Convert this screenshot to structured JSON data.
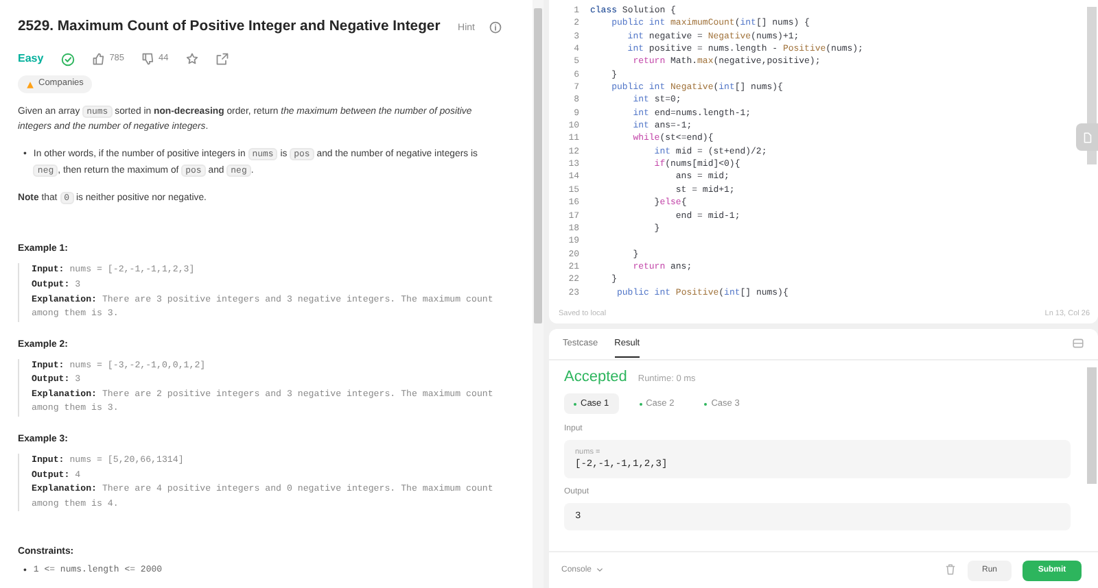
{
  "problem": {
    "title": "2529. Maximum Count of Positive Integer and Negative Integer",
    "hint": "Hint",
    "difficulty": "Easy",
    "solved": true,
    "likes": "785",
    "dislikes": "44",
    "companies": "Companies",
    "description": [
      {
        "kind": "plain",
        "text": "Given an array "
      },
      {
        "kind": "code",
        "text": "nums"
      },
      {
        "kind": "plain",
        "text": " sorted in "
      },
      {
        "kind": "bold",
        "text": "non-decreasing"
      },
      {
        "kind": "plain",
        "text": " order, return "
      },
      {
        "kind": "italic",
        "text": "the maximum between the number of positive integers and the number of negative integers"
      },
      {
        "kind": "plain",
        "text": "."
      }
    ],
    "bullets": [
      {
        "marker": "•",
        "text": [
          {
            "kind": "plain",
            "text": "In other words, if the number of positive integers in "
          },
          {
            "kind": "code",
            "text": "nums"
          },
          {
            "kind": "plain",
            "text": " is "
          },
          {
            "kind": "code",
            "text": "pos"
          },
          {
            "kind": "plain",
            "text": " and the number of negative integers is "
          },
          {
            "kind": "code",
            "text": "neg"
          },
          {
            "kind": "plain",
            "text": ", then return the maximum of "
          },
          {
            "kind": "code",
            "text": "pos"
          },
          {
            "kind": "plain",
            "text": " and "
          },
          {
            "kind": "code",
            "text": "neg"
          },
          {
            "kind": "plain",
            "text": "."
          }
        ]
      }
    ],
    "note": [
      {
        "kind": "bold",
        "text": "Note"
      },
      {
        "kind": "plain",
        "text": " that "
      },
      {
        "kind": "code",
        "text": "0"
      },
      {
        "kind": "plain",
        "text": " is neither positive nor negative."
      }
    ],
    "examples": [
      {
        "title": "Example 1:",
        "lines": [
          "**Input:** nums = [-2,-1,-1,1,2,3]",
          "**Output:** 3",
          "**Explanation:** There are 3 positive integers and 3 negative integers. The maximum count among them is 3."
        ]
      },
      {
        "title": "Example 2:",
        "lines": [
          "**Input:** nums = [-3,-2,-1,0,0,1,2]",
          "**Output:** 3",
          "**Explanation:** There are 2 positive integers and 3 negative integers. The maximum count among them is 3."
        ]
      },
      {
        "title": "Example 3:",
        "lines": [
          "**Input:** nums = [5,20,66,1314]",
          "**Output:** 4",
          "**Explanation:** There are 4 positive integers and 0 negative integers. The maximum count among them is 4."
        ]
      }
    ],
    "constraints_title": "Constraints:",
    "constraints": [
      {
        "marker": "•",
        "text": "1 <= nums.length <= 2000"
      }
    ]
  },
  "editor": {
    "lines": [
      {
        "number": "1",
        "tokens": [
          {
            "kind": "decl",
            "text": "class"
          },
          {
            "kind": "plain",
            "text": " Solution {"
          }
        ]
      },
      {
        "number": "2",
        "tokens": [
          {
            "kind": "kw",
            "text": "    public int "
          },
          {
            "kind": "fn",
            "text": "maximumCount"
          },
          {
            "kind": "plain",
            "text": "("
          },
          {
            "kind": "kw",
            "text": "int"
          },
          {
            "kind": "plain",
            "text": "[] nums) {"
          }
        ]
      },
      {
        "number": "3",
        "tokens": [
          {
            "kind": "kw",
            "text": "       int"
          },
          {
            "kind": "plain",
            "text": " negative = "
          },
          {
            "kind": "fn",
            "text": "Negative"
          },
          {
            "kind": "plain",
            "text": "(nums)+1;"
          }
        ]
      },
      {
        "number": "4",
        "tokens": [
          {
            "kind": "kw",
            "text": "       int"
          },
          {
            "kind": "plain",
            "text": " positive = nums.length - "
          },
          {
            "kind": "fn",
            "text": "Positive"
          },
          {
            "kind": "plain",
            "text": "(nums);"
          }
        ]
      },
      {
        "number": "5",
        "tokens": [
          {
            "kind": "ctl",
            "text": "        return"
          },
          {
            "kind": "plain",
            "text": " Math."
          },
          {
            "kind": "fn",
            "text": "max"
          },
          {
            "kind": "plain",
            "text": "(negative,positive);"
          }
        ]
      },
      {
        "number": "6",
        "tokens": [
          {
            "kind": "plain",
            "text": "    }"
          }
        ]
      },
      {
        "number": "7",
        "tokens": [
          {
            "kind": "kw",
            "text": "    public int "
          },
          {
            "kind": "fn",
            "text": "Negative"
          },
          {
            "kind": "plain",
            "text": "("
          },
          {
            "kind": "kw",
            "text": "int"
          },
          {
            "kind": "plain",
            "text": "[] nums){"
          }
        ]
      },
      {
        "number": "8",
        "tokens": [
          {
            "kind": "kw",
            "text": "        int"
          },
          {
            "kind": "plain",
            "text": " st=0;"
          }
        ]
      },
      {
        "number": "9",
        "tokens": [
          {
            "kind": "kw",
            "text": "        int"
          },
          {
            "kind": "plain",
            "text": " end=nums.length-1;"
          }
        ]
      },
      {
        "number": "10",
        "tokens": [
          {
            "kind": "kw",
            "text": "        int"
          },
          {
            "kind": "plain",
            "text": " ans=-1;"
          }
        ]
      },
      {
        "number": "11",
        "tokens": [
          {
            "kind": "ctl",
            "text": "        while"
          },
          {
            "kind": "plain",
            "text": "(st<=end){"
          }
        ]
      },
      {
        "number": "12",
        "tokens": [
          {
            "kind": "kw",
            "text": "            int"
          },
          {
            "kind": "plain",
            "text": " mid = (st+end)/2;"
          }
        ]
      },
      {
        "number": "13",
        "tokens": [
          {
            "kind": "ctl",
            "text": "            if"
          },
          {
            "kind": "plain",
            "text": "(nums[mid]<0){"
          }
        ]
      },
      {
        "number": "14",
        "tokens": [
          {
            "kind": "plain",
            "text": "                ans = mid;"
          }
        ]
      },
      {
        "number": "15",
        "tokens": [
          {
            "kind": "plain",
            "text": "                st = mid+1;"
          }
        ]
      },
      {
        "number": "16",
        "tokens": [
          {
            "kind": "plain",
            "text": "            }"
          },
          {
            "kind": "ctl",
            "text": "else"
          },
          {
            "kind": "plain",
            "text": "{"
          }
        ]
      },
      {
        "number": "17",
        "tokens": [
          {
            "kind": "plain",
            "text": "                end = mid-1;"
          }
        ]
      },
      {
        "number": "18",
        "tokens": [
          {
            "kind": "plain",
            "text": "            }"
          }
        ]
      },
      {
        "number": "19"
      },
      {
        "number": "20",
        "tokens": [
          {
            "kind": "plain",
            "text": "        }"
          }
        ]
      },
      {
        "number": "21",
        "tokens": [
          {
            "kind": "ctl",
            "text": "        return"
          },
          {
            "kind": "plain",
            "text": " ans;"
          }
        ]
      },
      {
        "number": "22",
        "tokens": [
          {
            "kind": "plain",
            "text": "    }"
          }
        ]
      },
      {
        "number": "23",
        "tokens": [
          {
            "kind": "kw",
            "text": "     public int "
          },
          {
            "kind": "fn",
            "text": "Positive"
          },
          {
            "kind": "plain",
            "text": "("
          },
          {
            "kind": "kw",
            "text": "int"
          },
          {
            "kind": "plain",
            "text": "[] nums){"
          }
        ]
      }
    ],
    "saved": "Saved to local",
    "cursor": "Ln 13, Col 26"
  },
  "console": {
    "tabs": [
      {
        "label": "Testcase",
        "selected": false
      },
      {
        "label": "Result",
        "selected": true
      }
    ],
    "verdict": "Accepted",
    "runtime": "Runtime: 0 ms",
    "cases": [
      {
        "label": "Case 1",
        "selected": true
      },
      {
        "label": "Case 2",
        "selected": false
      },
      {
        "label": "Case 3",
        "selected": false
      }
    ],
    "input_label": "Input",
    "param": "nums =",
    "input_value": "[-2,-1,-1,1,2,3]",
    "output_label": "Output",
    "output_value": "3",
    "console_button": "Console",
    "run": "Run",
    "submit": "Submit"
  }
}
